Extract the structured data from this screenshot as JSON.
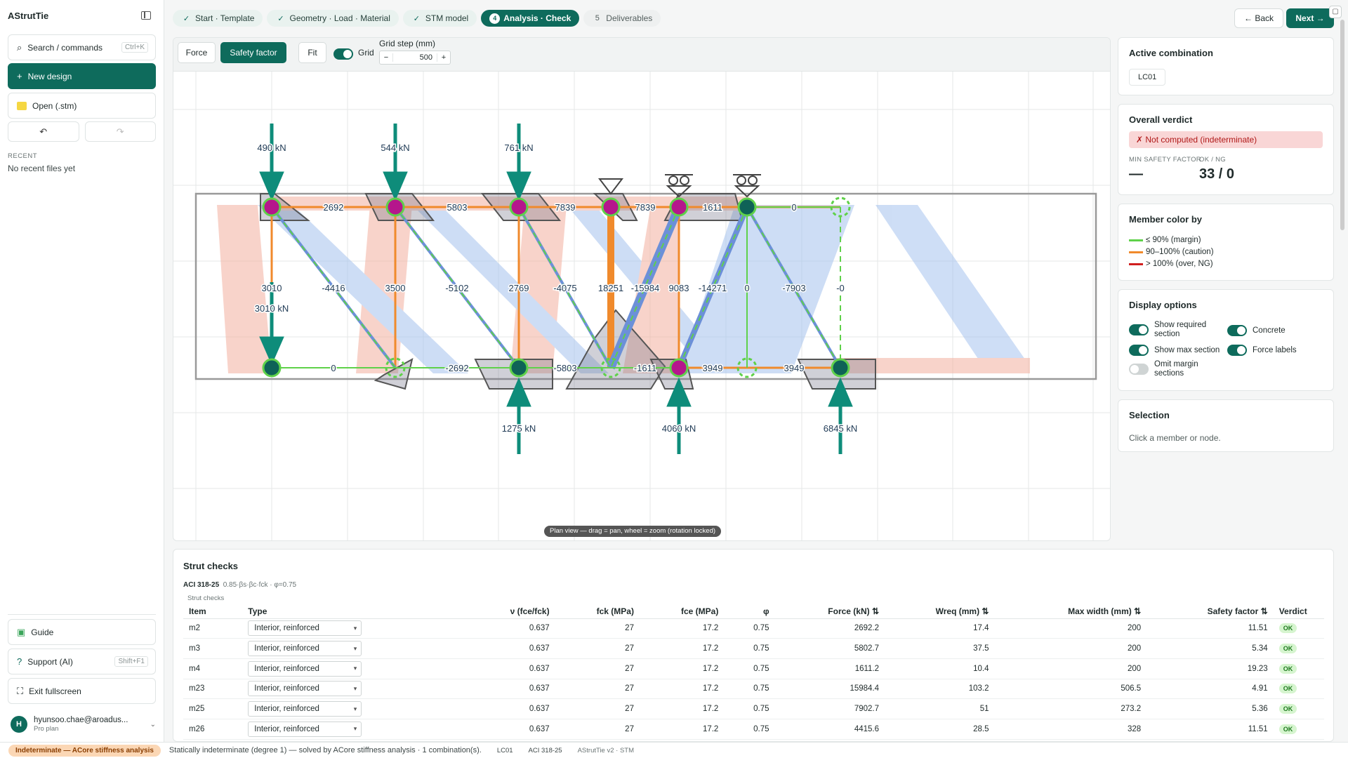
{
  "app": {
    "title": "AStrutTie"
  },
  "sidebar": {
    "search_label": "Search / commands",
    "search_kbd": "Ctrl+K",
    "new_design": "New design",
    "open": "Open (.stm)",
    "undo": "↶",
    "redo": "↷",
    "recent_heading": "RECENT",
    "recent_empty": "No recent files yet",
    "guide": "Guide",
    "support": "Support (AI)",
    "support_kbd": "Shift+F1",
    "exit_fullscreen": "Exit fullscreen",
    "user_initial": "H",
    "user_name": "hyunsoo.chae@aroadus...",
    "user_plan": "Pro plan"
  },
  "steps": [
    {
      "num": "✓",
      "label": "Start · Template"
    },
    {
      "num": "✓",
      "label": "Geometry · Load · Material"
    },
    {
      "num": "✓",
      "label": "STM model"
    },
    {
      "num": "4",
      "label": "Analysis · Check"
    },
    {
      "num": "5",
      "label": "Deliverables"
    }
  ],
  "nav": {
    "back": "← Back",
    "next": "Next →"
  },
  "toolbar": {
    "force": "Force",
    "safety_factor": "Safety factor",
    "fit": "Fit",
    "grid": "Grid",
    "grid_step_label": "Grid step (mm)",
    "grid_step_value": "500",
    "minus": "−",
    "plus": "+"
  },
  "canvas": {
    "hint": "Plan view — drag = pan, wheel = zoom (rotation locked)",
    "loads": [
      "490 kN",
      "544 kN",
      "761 kN",
      "3010 kN",
      "1275 kN",
      "4060 kN",
      "6845 kN"
    ],
    "top_chord": [
      "2692",
      "5803",
      "7839",
      "7839",
      "1611",
      "0"
    ],
    "bottom_chord": [
      "0",
      "-2692",
      "-5803",
      "-1611",
      "3949",
      "3949"
    ],
    "webs": [
      "3010",
      "-4416",
      "3500",
      "-5102",
      "2769",
      "-4075",
      "18251",
      "-15984",
      "9083",
      "-14271",
      "0",
      "-7903",
      "-0"
    ]
  },
  "right": {
    "active_combo_title": "Active combination",
    "active_combo": "LC01",
    "verdict_title": "Overall verdict",
    "verdict_text": "✗ Not computed (indeterminate)",
    "min_sf_label": "MIN SAFETY FACTOR",
    "ok_ng_label": "OK / NG",
    "min_sf_value": "—",
    "ok_ng_value": "33 / 0",
    "member_color_title": "Member color by",
    "legend": [
      {
        "label": "≤ 90% (margin)",
        "color": "#5fd14a"
      },
      {
        "label": "90–100% (caution)",
        "color": "#f08a2c"
      },
      {
        "label": "> 100% (over, NG)",
        "color": "#d01e1e"
      }
    ],
    "display_title": "Display options",
    "opt_required": "Show required section",
    "opt_concrete": "Concrete",
    "opt_max": "Show max section",
    "opt_force": "Force labels",
    "opt_omit": "Omit margin sections",
    "selection_title": "Selection",
    "selection_hint": "Click a member or node."
  },
  "checks": {
    "title": "Strut checks",
    "code": "ACI 318-25",
    "formula": "0.85·βs·βc·fck · φ=0.75",
    "sub": "Strut checks",
    "headers": [
      "Item",
      "Type",
      "ν (fce/fck)",
      "fck (MPa)",
      "fce (MPa)",
      "φ",
      "Force (kN) ⇅",
      "Wreq (mm) ⇅",
      "Max width (mm) ⇅",
      "Safety factor ⇅",
      "Verdict"
    ],
    "rows": [
      [
        "m2",
        "Interior, reinforced",
        "0.637",
        "27",
        "17.2",
        "0.75",
        "2692.2",
        "17.4",
        "200",
        "11.51",
        "OK"
      ],
      [
        "m3",
        "Interior, reinforced",
        "0.637",
        "27",
        "17.2",
        "0.75",
        "5802.7",
        "37.5",
        "200",
        "5.34",
        "OK"
      ],
      [
        "m4",
        "Interior, reinforced",
        "0.637",
        "27",
        "17.2",
        "0.75",
        "1611.2",
        "10.4",
        "200",
        "19.23",
        "OK"
      ],
      [
        "m23",
        "Interior, reinforced",
        "0.637",
        "27",
        "17.2",
        "0.75",
        "15984.4",
        "103.2",
        "506.5",
        "4.91",
        "OK"
      ],
      [
        "m25",
        "Interior, reinforced",
        "0.637",
        "27",
        "17.2",
        "0.75",
        "7902.7",
        "51",
        "273.2",
        "5.36",
        "OK"
      ],
      [
        "m26",
        "Interior, reinforced",
        "0.637",
        "27",
        "17.2",
        "0.75",
        "4415.6",
        "28.5",
        "328",
        "11.51",
        "OK"
      ]
    ]
  },
  "status": {
    "badge": "Indeterminate — ACore stiffness analysis",
    "text": "Statically indeterminate (degree 1) — solved by ACore stiffness analysis · 1 combination(s).",
    "combo": "LC01",
    "code": "ACI 318-25",
    "version": "AStrutTie v2 · STM"
  }
}
